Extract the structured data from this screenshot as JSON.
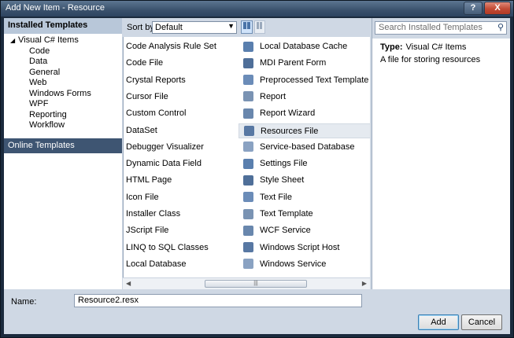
{
  "window": {
    "title": "Add New Item - Resource",
    "help_label": "?",
    "close_label": "X"
  },
  "left_pane": {
    "header": "Installed Templates",
    "root": "Visual C# Items",
    "items": [
      "Code",
      "Data",
      "General",
      "Web",
      "Windows Forms",
      "WPF",
      "Reporting",
      "Workflow"
    ],
    "online": "Online Templates"
  },
  "toolbar": {
    "sort_label": "Sort by:",
    "sort_value": "Default"
  },
  "templates": {
    "col1": [
      "Code Analysis Rule Set",
      "Code File",
      "Crystal Reports",
      "Cursor File",
      "Custom Control",
      "DataSet",
      "Debugger Visualizer",
      "Dynamic Data Field",
      "HTML Page",
      "Icon File",
      "Installer Class",
      "JScript File",
      "LINQ to SQL Classes",
      "Local Database"
    ],
    "col2": [
      "Local Database Cache",
      "MDI Parent Form",
      "Preprocessed Text Template",
      "Report",
      "Report Wizard",
      "Resources File",
      "Service-based Database",
      "Settings File",
      "Style Sheet",
      "Text File",
      "Text Template",
      "WCF Service",
      "Windows Script Host",
      "Windows Service"
    ],
    "selected": "Resources File"
  },
  "search": {
    "placeholder": "Search Installed Templates"
  },
  "details": {
    "type_label": "Type:",
    "type_value": "Visual C# Items",
    "description": "A file for storing resources"
  },
  "bottom": {
    "name_label": "Name:",
    "name_value": "Resource2.resx",
    "add_label": "Add",
    "cancel_label": "Cancel"
  },
  "colors": {
    "accent": "#3e5572",
    "header": "#b8c7d9",
    "chrome": "#cfd8e4"
  }
}
